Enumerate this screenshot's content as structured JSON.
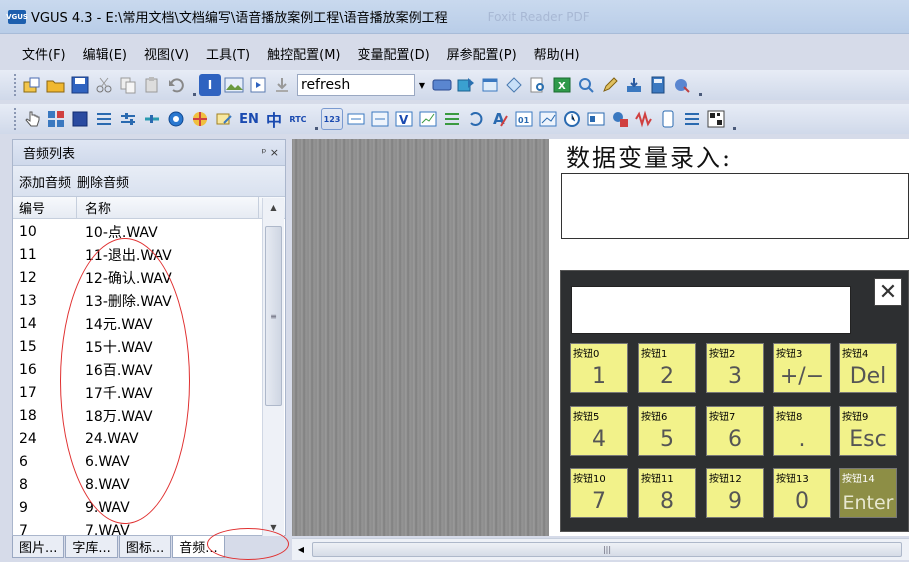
{
  "window": {
    "app_icon_text": "VGUS",
    "title": "VGUS 4.3 - E:\\常用文档\\文档编写\\语音播放案例工程\\语音播放案例工程",
    "ghost_text": "Foxit Reader PDF"
  },
  "menu": [
    "文件(F)",
    "编辑(E)",
    "视图(V)",
    "工具(T)",
    "触控配置(M)",
    "变量配置(D)",
    "屏参配置(P)",
    "帮助(H)"
  ],
  "toolbar": {
    "combo_value": "refresh",
    "text_icons": {
      "en": "EN",
      "zh": "中",
      "rtc": "RTC",
      "num": "123"
    }
  },
  "audio_panel": {
    "title": "音频列表",
    "pin": "ᵖ ×",
    "add_label": "添加音频",
    "delete_label": "删除音频",
    "col_num": "编号",
    "col_name": "名称",
    "rows": [
      {
        "num": "10",
        "name": "10-点.WAV"
      },
      {
        "num": "11",
        "name": "11-退出.WAV"
      },
      {
        "num": "12",
        "name": "12-确认.WAV"
      },
      {
        "num": "13",
        "name": "13-删除.WAV"
      },
      {
        "num": "14",
        "name": "14元.WAV"
      },
      {
        "num": "15",
        "name": "15十.WAV"
      },
      {
        "num": "16",
        "name": "16百.WAV"
      },
      {
        "num": "17",
        "name": "17千.WAV"
      },
      {
        "num": "18",
        "name": "18万.WAV"
      },
      {
        "num": "24",
        "name": "24.WAV"
      },
      {
        "num": "6",
        "name": "6.WAV"
      },
      {
        "num": "8",
        "name": "8.WAV"
      },
      {
        "num": "9",
        "name": "9.WAV"
      },
      {
        "num": "7",
        "name": "7.WAV"
      }
    ]
  },
  "bottom_tabs": [
    "图片...",
    "字库...",
    "图标...",
    "音频..."
  ],
  "canvas": {
    "heading": "数据变量录入:",
    "close_glyph": "✕",
    "keys": [
      {
        "label": "按钮0",
        "value": "1"
      },
      {
        "label": "按钮1",
        "value": "2"
      },
      {
        "label": "按钮2",
        "value": "3"
      },
      {
        "label": "按钮3",
        "value": "+/−"
      },
      {
        "label": "按钮4",
        "value": "Del"
      },
      {
        "label": "按钮5",
        "value": "4"
      },
      {
        "label": "按钮6",
        "value": "5"
      },
      {
        "label": "按钮7",
        "value": "6"
      },
      {
        "label": "按钮8",
        "value": "."
      },
      {
        "label": "按钮9",
        "value": "Esc"
      },
      {
        "label": "按钮10",
        "value": "7"
      },
      {
        "label": "按钮11",
        "value": "8"
      },
      {
        "label": "按钮12",
        "value": "9"
      },
      {
        "label": "按钮13",
        "value": "0"
      },
      {
        "label": "按钮14",
        "value": "Enter"
      }
    ]
  },
  "colors": {
    "key": "#f2f28a",
    "enter_key": "#8d8e45",
    "keypad_bg": "#2d2f31",
    "annotation": "#e03030"
  }
}
